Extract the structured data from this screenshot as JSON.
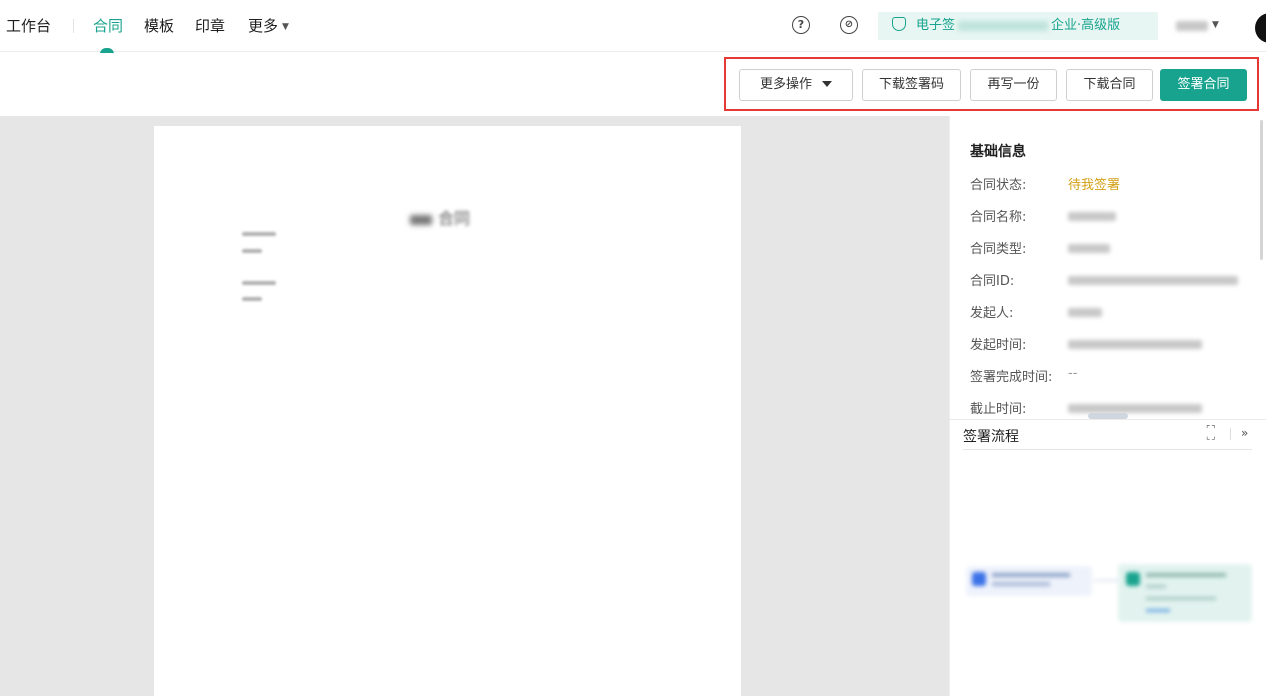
{
  "nav": {
    "workbench": "工作台",
    "items": [
      {
        "label": "合同",
        "active": true
      },
      {
        "label": "模板",
        "active": false
      },
      {
        "label": "印章",
        "active": false
      },
      {
        "label": "更多",
        "active": false
      }
    ]
  },
  "header": {
    "help_icon": "question-circle-icon",
    "link_icon": "link-circle-icon",
    "edition_prefix": "电子签",
    "edition_suffix": "企业·高级版"
  },
  "toolbar": {
    "more_actions": "更多操作",
    "download_sign_code": "下载签署码",
    "write_another": "再写一份",
    "download_contract": "下载合同",
    "sign_contract": "签署合同"
  },
  "document": {
    "title_suffix": "合同"
  },
  "basic_info": {
    "title": "基础信息",
    "rows": [
      {
        "label": "合同状态:",
        "value": "待我签署"
      },
      {
        "label": "合同名称:",
        "value": ""
      },
      {
        "label": "合同类型:",
        "value": ""
      },
      {
        "label": "合同ID:",
        "value": ""
      },
      {
        "label": "发起人:",
        "value": ""
      },
      {
        "label": "发起时间:",
        "value": ""
      },
      {
        "label": "签署完成时间:",
        "value": "--"
      },
      {
        "label": "截止时间:",
        "value": ""
      }
    ]
  },
  "flow": {
    "title": "签署流程"
  },
  "colors": {
    "accent": "#18a38e",
    "status_pending": "#d4a017",
    "highlight_border": "#e53935"
  }
}
